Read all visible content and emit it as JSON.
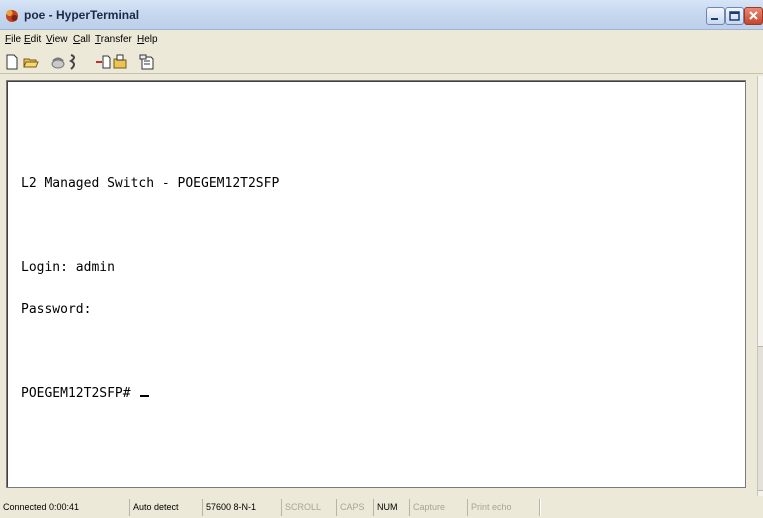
{
  "window": {
    "title": "poe - HyperTerminal",
    "icon": "hyperterminal-phone-icon",
    "controls": [
      "minimize-icon",
      "maximize-icon",
      "close-icon"
    ]
  },
  "menu": {
    "items": [
      {
        "label": "File",
        "mnemonic": "F"
      },
      {
        "label": "Edit",
        "mnemonic": "E"
      },
      {
        "label": "View",
        "mnemonic": "V"
      },
      {
        "label": "Call",
        "mnemonic": "C"
      },
      {
        "label": "Transfer",
        "mnemonic": "T"
      },
      {
        "label": "Help",
        "mnemonic": "H"
      }
    ]
  },
  "toolbar": {
    "buttons": [
      "new-icon",
      "open-icon",
      "connect-icon",
      "disconnect-icon",
      "send-icon",
      "receive-icon",
      "properties-icon"
    ]
  },
  "terminal": {
    "lines": [
      "",
      "L2 Managed Switch - POEGEM12T2SFP",
      "",
      "Login: admin",
      "Password:",
      "",
      "POEGEM12T2SFP# "
    ]
  },
  "status": {
    "connected": "Connected 0:00:41",
    "detect": "Auto detect",
    "baud": "57600 8-N-1",
    "scroll": "SCROLL",
    "caps": "CAPS",
    "num": "NUM",
    "capture": "Capture",
    "print_echo": "Print echo"
  },
  "colors": {
    "titlebar": "#c7d8ee",
    "chrome": "#ece9d8",
    "terminal_bg": "#ffffff",
    "terminal_text": "#000000"
  }
}
